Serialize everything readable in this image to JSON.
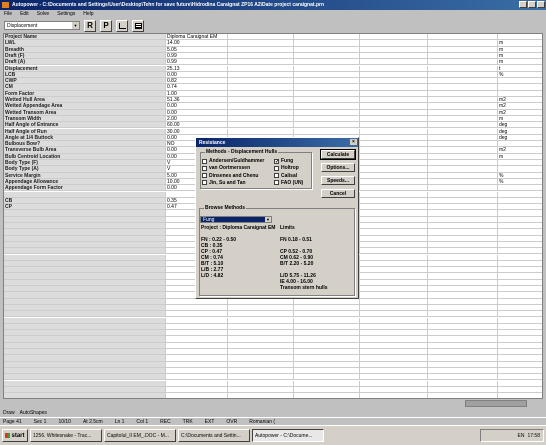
{
  "window": {
    "title": "Autopower - C:\\Documents and Settings\\User\\Desktop\\Tehn for save future\\Hidrodina Caraignat ZP16 A2\\Date project caraignat.prn"
  },
  "menu": [
    "File",
    "Edit",
    "Solve",
    "Settings",
    "Help"
  ],
  "toolbar": {
    "combo_value": "Displacement",
    "btn_r": "R",
    "btn_p": "P"
  },
  "grid": {
    "header": [
      "Project Name",
      "Diploma Caraignat EM",
      "",
      "",
      "",
      "",
      ""
    ],
    "rows": [
      [
        "LWL",
        "14.00",
        "",
        "",
        "",
        "",
        "m"
      ],
      [
        "Breadth",
        "5.05",
        "",
        "",
        "",
        "",
        "m"
      ],
      [
        "Draft (F)",
        "0.99",
        "",
        "",
        "",
        "",
        "m"
      ],
      [
        "Draft (A)",
        "0.99",
        "",
        "",
        "",
        "",
        "m"
      ],
      [
        "Displacement",
        "25.13",
        "",
        "",
        "",
        "",
        "t"
      ],
      [
        "LCB",
        "0.00",
        "",
        "",
        "",
        "",
        "%"
      ],
      [
        "CWP",
        "0.82",
        "",
        "",
        "",
        "",
        ""
      ],
      [
        "CM",
        "0.74",
        "",
        "",
        "",
        "",
        ""
      ],
      [
        "Form Factor",
        "1.00",
        "",
        "",
        "",
        "",
        ""
      ],
      [
        "Wetted Hull Area",
        "51.36",
        "",
        "",
        "",
        "",
        "m2"
      ],
      [
        "Wetted Appendage Area",
        "0.00",
        "",
        "",
        "",
        "",
        "m2"
      ],
      [
        "Wetted Transom Area",
        "0.00",
        "",
        "",
        "",
        "",
        "m2"
      ],
      [
        "Transom Width",
        "2.00",
        "",
        "",
        "",
        "",
        "m"
      ],
      [
        "Half Angle of Entrance",
        "60.00",
        "",
        "",
        "",
        "",
        "deg"
      ],
      [
        "Half Angle of Run",
        "30.00",
        "",
        "",
        "",
        "",
        "deg"
      ],
      [
        "Angle at 1/4 Buttock",
        "0.00",
        "",
        "",
        "",
        "",
        "deg"
      ],
      [
        "Bulbous Bow?",
        "NO",
        "",
        "",
        "",
        "",
        ""
      ],
      [
        "Transverse Bulb Area",
        "0.00",
        "",
        "",
        "",
        "",
        "m2"
      ],
      [
        "Bulb Centroid Location",
        "0.00",
        "",
        "",
        "",
        "",
        "m"
      ],
      [
        "Body Type (F)",
        "V",
        "",
        "",
        "",
        "",
        ""
      ],
      [
        "Body Type (A)",
        "V",
        "",
        "",
        "",
        "",
        ""
      ],
      [
        "Service Margin",
        "5.00",
        "",
        "",
        "",
        "",
        "%"
      ],
      [
        "Appendage Allowance",
        "10.00",
        "",
        "",
        "",
        "",
        "%"
      ],
      [
        "Appendage Form Factor",
        "0.00",
        "",
        "",
        "",
        "",
        ""
      ],
      [
        "",
        "",
        "",
        "",
        "",
        "",
        ""
      ],
      [
        "CB",
        "0.35",
        "",
        "",
        "",
        "",
        ""
      ],
      [
        "CP",
        "0.47",
        "",
        "",
        "",
        "",
        ""
      ]
    ]
  },
  "dialog": {
    "title": "Resistance",
    "close": "×",
    "methods_label": "Methods - Displacement Hulls",
    "methods_left": [
      {
        "label": "Andersen/Guldhammer",
        "checked": false
      },
      {
        "label": "van Oortmerssen",
        "checked": false
      },
      {
        "label": "Dinsenes and Chenu",
        "checked": false
      },
      {
        "label": "Jin, Su and Tan",
        "checked": false
      }
    ],
    "methods_right": [
      {
        "label": "Fung",
        "checked": true
      },
      {
        "label": "Holtrop",
        "checked": false
      },
      {
        "label": "Calisal",
        "checked": false
      },
      {
        "label": "FAO (UN)",
        "checked": false
      }
    ],
    "buttons": [
      "Calculate",
      "Options...",
      "Speeds...",
      "Cancel"
    ],
    "browse_label": "Browse Methods",
    "browse_value": "Fung",
    "project_lines": [
      "Project : Diploma Caraignat EM",
      "",
      "FN   :  0.22 - 0.50",
      "CB   :  0.35",
      "CP   :  0.47",
      "CM   :  0.74",
      "B/T  :  5.10",
      "L/B  :  2.77",
      "L/D  :  4.82"
    ],
    "limit_lines": [
      "Limits",
      "",
      "FN   0.18 -  0.51",
      "",
      "CP  0.52 -  0.70",
      "CM  0.62 -  0.90",
      "B/T  2.20 -  5.20",
      "",
      "L/D  5.75 - 11.26",
      "IE   4.00 - 16.00",
      "Transom stern hulls"
    ]
  },
  "drawbar": {
    "draw": "Draw",
    "autoshapes": "AutoShapes"
  },
  "status": [
    "Page 41",
    "Sec 1",
    "10/10",
    "At 2.5cm",
    "Ln 1",
    "Col 1",
    "REC",
    "TRK",
    "EXT",
    "OVR",
    "Romanian ("
  ],
  "taskbar": {
    "start": "start",
    "tasks": [
      "1256. Whitesnake - Trac...",
      "Capitolul_II EM_.DOC - M...",
      "C:\\Documents and Settin...",
      "Autopower - C:\\Docume..."
    ],
    "lang": "EN",
    "time": "17:58"
  }
}
